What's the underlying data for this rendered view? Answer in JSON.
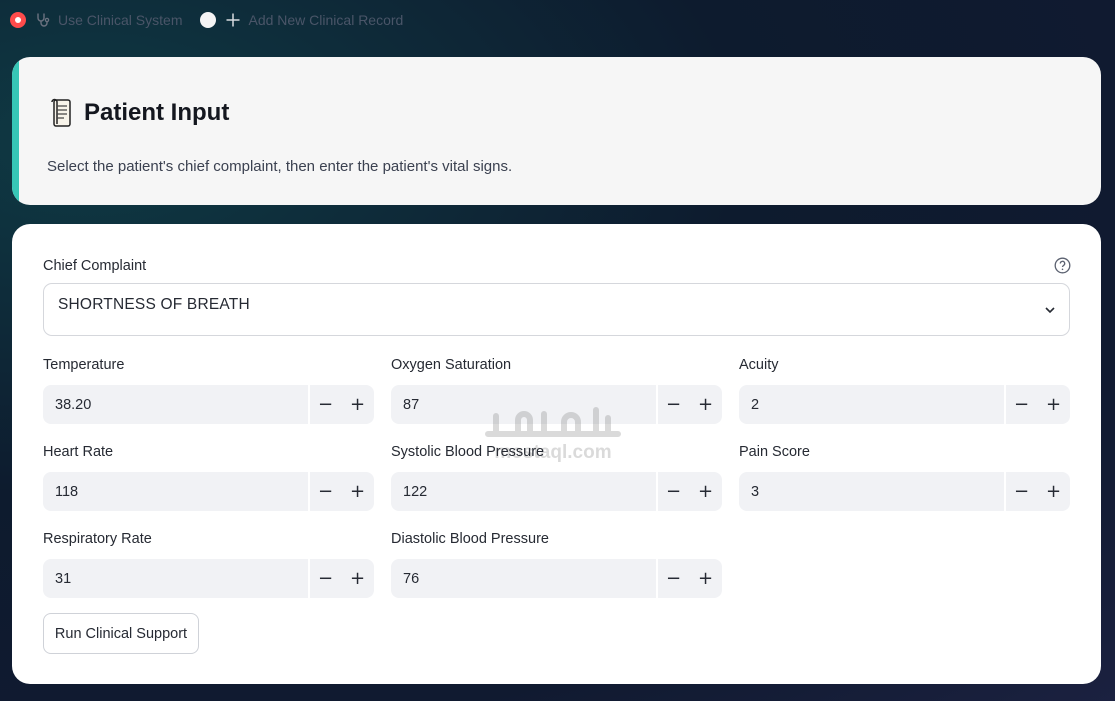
{
  "nav": {
    "items": [
      {
        "label": "Use Clinical System",
        "icon": "stethoscope-icon",
        "active": true
      },
      {
        "label": "Add New Clinical Record",
        "icon": "plus-icon",
        "active": false
      }
    ]
  },
  "header": {
    "icon": "scroll-icon",
    "title": "Patient Input",
    "subtitle": "Select the patient's chief complaint, then enter the patient's vital signs."
  },
  "form": {
    "chief_complaint": {
      "label": "Chief Complaint",
      "value": "SHORTNESS OF BREATH",
      "help_icon": "question-circle-icon"
    },
    "fields": {
      "temperature": {
        "label": "Temperature",
        "value": "38.20"
      },
      "oxygen_saturation": {
        "label": "Oxygen Saturation",
        "value": "87"
      },
      "acuity": {
        "label": "Acuity",
        "value": "2"
      },
      "heart_rate": {
        "label": "Heart Rate",
        "value": "118"
      },
      "systolic_bp": {
        "label": "Systolic Blood Pressure",
        "value": "122"
      },
      "pain_score": {
        "label": "Pain Score",
        "value": "3"
      },
      "respiratory_rate": {
        "label": "Respiratory Rate",
        "value": "31"
      },
      "diastolic_bp": {
        "label": "Diastolic Blood Pressure",
        "value": "76"
      }
    },
    "stepper": {
      "minus": "−",
      "plus": "+"
    },
    "run_button": "Run Clinical Support"
  },
  "watermark": {
    "brand": "مستقل",
    "domain": "mostaql.com"
  },
  "colors": {
    "accent": "#37c6b6",
    "active_radio": "#ff4b4b",
    "card": "#f6f6f6",
    "input_bg": "#f1f2f5"
  }
}
